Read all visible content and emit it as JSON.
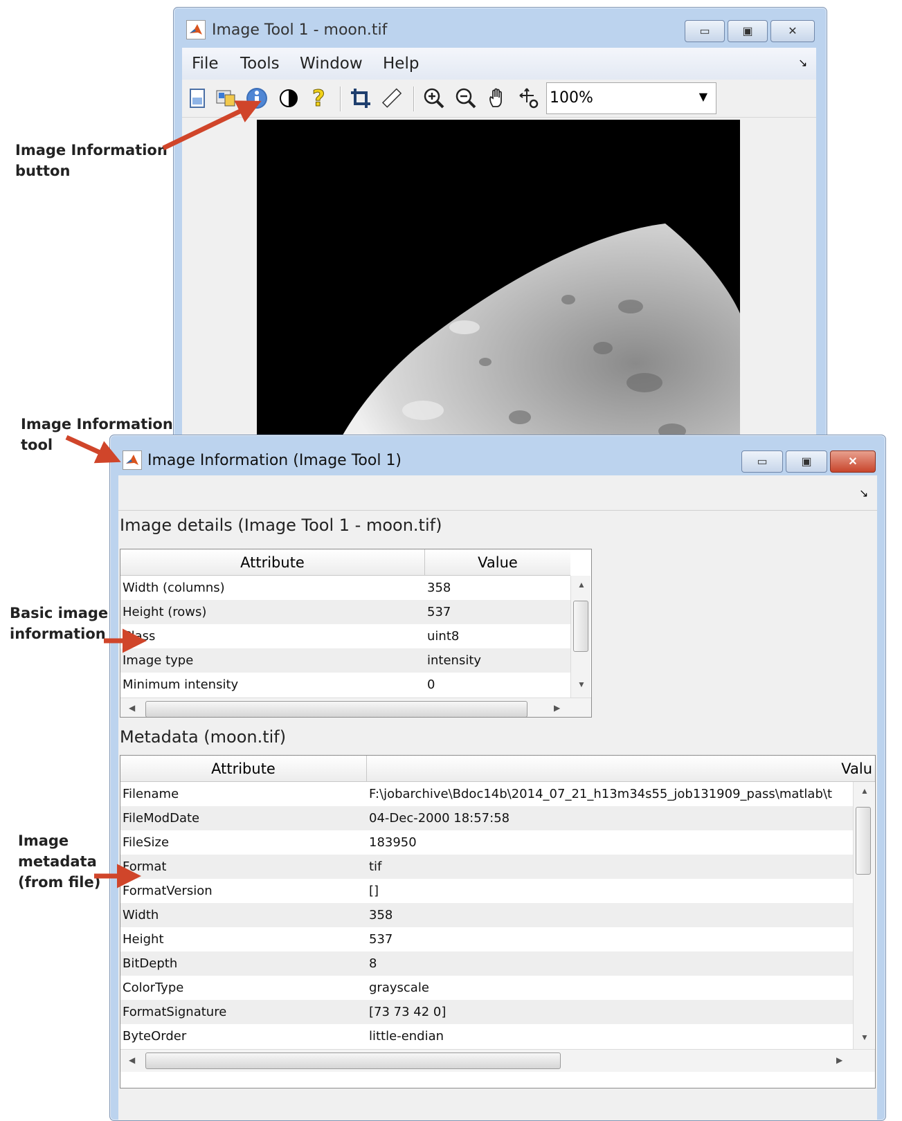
{
  "callouts": {
    "info_button": [
      "Image Information",
      "button"
    ],
    "info_tool": [
      "Image Information",
      "tool"
    ],
    "basic_info": [
      "Basic image",
      "information"
    ],
    "metadata": [
      "Image",
      "metadata",
      "(from file)"
    ]
  },
  "imtool": {
    "title": "Image Tool 1 - moon.tif",
    "menu": [
      "File",
      "Tools",
      "Window",
      "Help"
    ],
    "zoom": "100%",
    "toolbar_icons": [
      "new-figure-icon",
      "export-icon",
      "image-information-icon",
      "adjust-contrast-icon",
      "pixel-region-icon",
      "crop-icon",
      "measure-distance-icon",
      "zoom-in-icon",
      "zoom-out-icon",
      "pan-icon",
      "overview-icon"
    ]
  },
  "info_window": {
    "title": "Image Information (Image Tool 1)",
    "details_title": "Image details  (Image Tool 1 - moon.tif)",
    "details_headers": [
      "Attribute",
      "Value"
    ],
    "details_rows": [
      [
        "Width (columns)",
        "358"
      ],
      [
        "Height (rows)",
        "537"
      ],
      [
        "Class",
        "uint8"
      ],
      [
        "Image type",
        "intensity"
      ],
      [
        "Minimum intensity",
        "0"
      ]
    ],
    "metadata_title": "Metadata (moon.tif)",
    "metadata_headers": [
      "Attribute",
      "Valu"
    ],
    "metadata_rows": [
      [
        "Filename",
        "F:\\jobarchive\\Bdoc14b\\2014_07_21_h13m34s55_job131909_pass\\matlab\\t"
      ],
      [
        "FileModDate",
        "04-Dec-2000 18:57:58"
      ],
      [
        "FileSize",
        "183950"
      ],
      [
        "Format",
        "tif"
      ],
      [
        "FormatVersion",
        "[]"
      ],
      [
        "Width",
        "358"
      ],
      [
        "Height",
        "537"
      ],
      [
        "BitDepth",
        "8"
      ],
      [
        "ColorType",
        "grayscale"
      ],
      [
        "FormatSignature",
        "[73 73 42 0]"
      ],
      [
        "ByteOrder",
        "little-endian"
      ]
    ]
  },
  "colors": {
    "arrow": "#d0452a",
    "window_frame": "#bcd3ee"
  }
}
